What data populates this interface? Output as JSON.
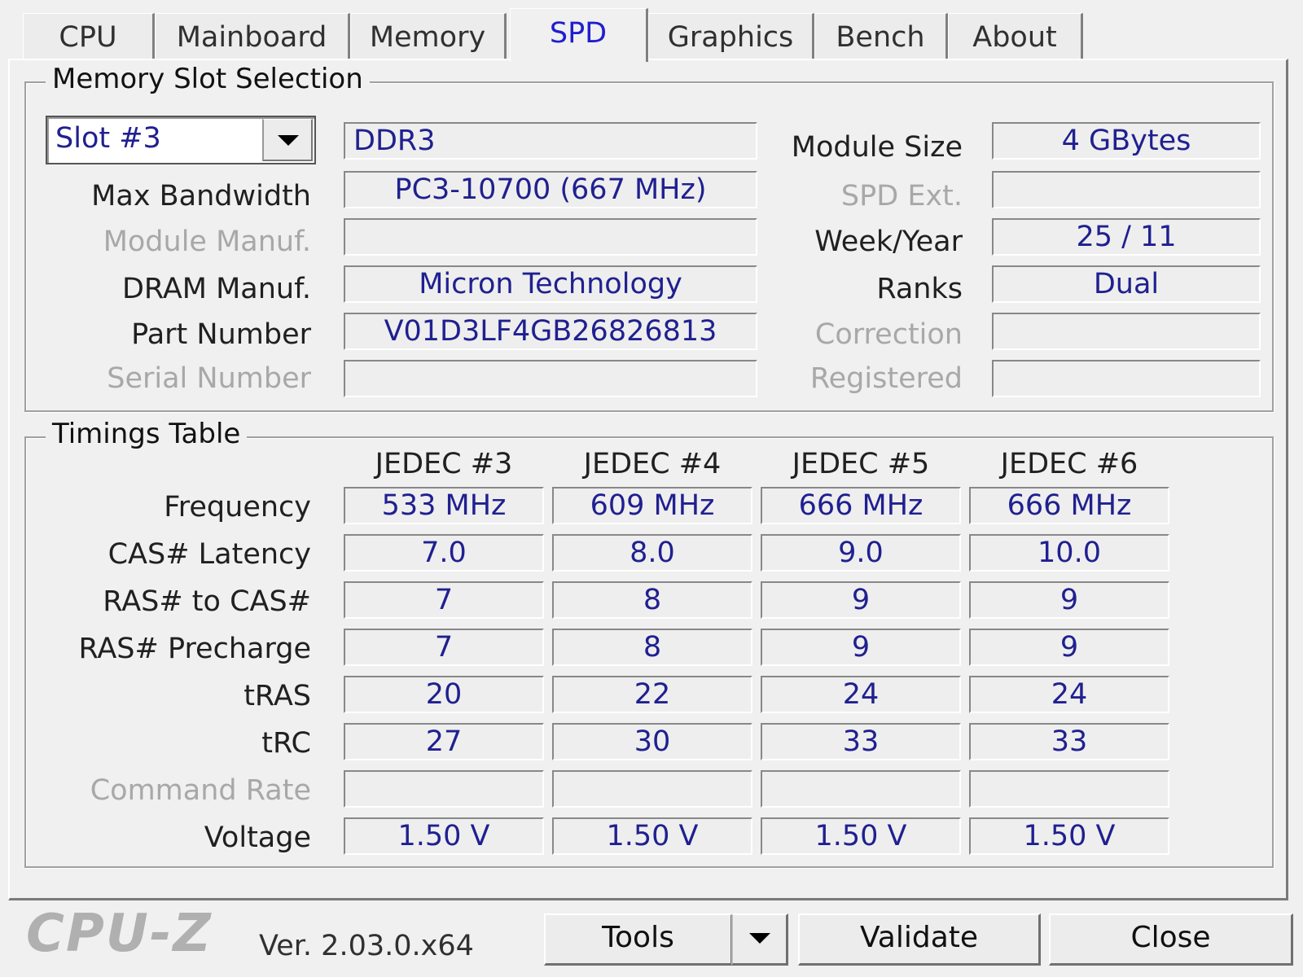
{
  "tabs": [
    "CPU",
    "Mainboard",
    "Memory",
    "SPD",
    "Graphics",
    "Bench",
    "About"
  ],
  "active_tab": "SPD",
  "slot_group": {
    "legend": "Memory Slot Selection",
    "slot_value": "Slot #3",
    "memory_type": "DDR3",
    "left": [
      {
        "label": "Max Bandwidth",
        "value": "PC3-10700 (667 MHz)",
        "enabled": true
      },
      {
        "label": "Module Manuf.",
        "value": "",
        "enabled": false
      },
      {
        "label": "DRAM Manuf.",
        "value": "Micron Technology",
        "enabled": true
      },
      {
        "label": "Part Number",
        "value": "V01D3LF4GB26826813",
        "enabled": true
      },
      {
        "label": "Serial Number",
        "value": "",
        "enabled": false
      }
    ],
    "right": [
      {
        "label": "Module Size",
        "value": "4 GBytes",
        "enabled": true
      },
      {
        "label": "SPD Ext.",
        "value": "",
        "enabled": false
      },
      {
        "label": "Week/Year",
        "value": "25 / 11",
        "enabled": true
      },
      {
        "label": "Ranks",
        "value": "Dual",
        "enabled": true
      },
      {
        "label": "Correction",
        "value": "",
        "enabled": false
      },
      {
        "label": "Registered",
        "value": "",
        "enabled": false
      }
    ]
  },
  "timings": {
    "legend": "Timings Table",
    "columns": [
      "JEDEC #3",
      "JEDEC #4",
      "JEDEC #5",
      "JEDEC #6"
    ],
    "rows": [
      {
        "label": "Frequency",
        "enabled": true,
        "values": [
          "533 MHz",
          "609 MHz",
          "666 MHz",
          "666 MHz"
        ]
      },
      {
        "label": "CAS# Latency",
        "enabled": true,
        "values": [
          "7.0",
          "8.0",
          "9.0",
          "10.0"
        ]
      },
      {
        "label": "RAS# to CAS#",
        "enabled": true,
        "values": [
          "7",
          "8",
          "9",
          "9"
        ]
      },
      {
        "label": "RAS# Precharge",
        "enabled": true,
        "values": [
          "7",
          "8",
          "9",
          "9"
        ]
      },
      {
        "label": "tRAS",
        "enabled": true,
        "values": [
          "20",
          "22",
          "24",
          "24"
        ]
      },
      {
        "label": "tRC",
        "enabled": true,
        "values": [
          "27",
          "30",
          "33",
          "33"
        ]
      },
      {
        "label": "Command Rate",
        "enabled": false,
        "values": [
          "",
          "",
          "",
          ""
        ]
      },
      {
        "label": "Voltage",
        "enabled": true,
        "values": [
          "1.50 V",
          "1.50 V",
          "1.50 V",
          "1.50 V"
        ]
      }
    ]
  },
  "footer": {
    "logo": "CPU-Z",
    "version": "Ver. 2.03.0.x64",
    "tools_label": "Tools",
    "validate_label": "Validate",
    "close_label": "Close"
  }
}
